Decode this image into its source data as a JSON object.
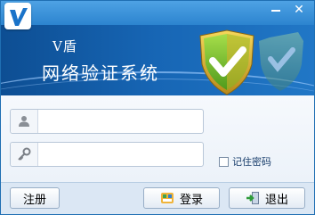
{
  "window": {
    "close_label": "✕"
  },
  "banner": {
    "title_line1": "V盾",
    "title_line2": "网络验证系统"
  },
  "form": {
    "username": {
      "value": "",
      "placeholder": ""
    },
    "password": {
      "value": "",
      "placeholder": ""
    },
    "remember_label": "记住密码"
  },
  "footer": {
    "register_label": "注册",
    "login_label": "登录",
    "exit_label": "退出"
  },
  "icons": {
    "logo": "v-logo-icon",
    "user": "user-icon",
    "key": "key-icon",
    "login": "login-icon",
    "exit": "exit-icon",
    "shield": "shield-icon"
  },
  "colors": {
    "titlebar": "#2c84cf",
    "banner": "#1766b5",
    "shield_green": "#7fbf2a",
    "shield_gold": "#d9b02a"
  }
}
